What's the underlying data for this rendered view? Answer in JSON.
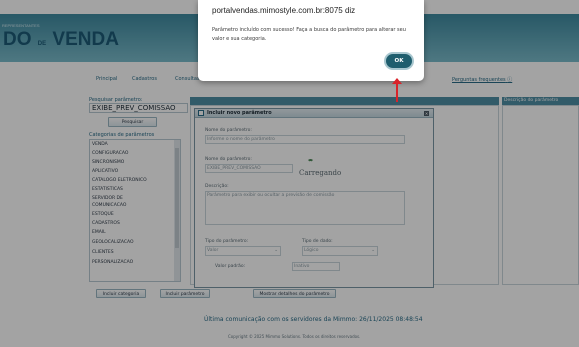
{
  "header": {
    "brand_small": "REPRESENTANTES",
    "brand_left": "DO",
    "brand_de": "DE",
    "brand_right": "VENDA"
  },
  "nav": {
    "items": [
      "Principal",
      "Cadastros",
      "Consultas"
    ],
    "help_link": "Perguntas frequentes"
  },
  "left_panel": {
    "search_label": "Pesquisar parâmetro:",
    "search_value": "EXIBE_PREV_COMISSAO",
    "search_button": "Pesquisar",
    "categories_label": "Categorias de parâmetros",
    "categories": [
      "VENDA",
      "CONFIGURACAO",
      "SINCRONISMO",
      "APLICATIVO",
      "CATALOGO ELETRONICO",
      "ESTATISTICAS",
      "SERVIDOR DE",
      "COMUNICACAO",
      "ESTOQUE",
      "CADASTROS",
      "EMAIL",
      "GEOLOCALIZACAO",
      "CLIENTES",
      "PERSONALIZACAO"
    ]
  },
  "bottom_buttons": {
    "add_category": "Incluir categoria",
    "add_parameter": "Incluir parâmetro",
    "show_details": "Mostrar detalhes do parâmetro"
  },
  "right_panel": {
    "description_header": "Descrição do parâmetro"
  },
  "footer": {
    "last_comm": "Última comunicação com os servidores da Mimmo: 26/11/2025 08:48:54",
    "copyright": "Copyright © 2025 Mimmo Solutions. Todos os direitos reservados."
  },
  "modal": {
    "title": "Incluir novo parâmetro",
    "name_label": "Nome do parâmetro:",
    "name_placeholder": "Informe o nome do parâmetro",
    "short_name_label": "Nome do parâmetro:",
    "short_name_value": "EXIBE_PREV_COMISSAO",
    "description_label": "Descrição:",
    "description_value": "Parâmetro para exibir ou ocultar a previsão de comissão",
    "type_label": "Tipo do parâmetro:",
    "type_value": "Valor",
    "data_type_label": "Tipo de dado:",
    "data_type_value": "Lógico",
    "default_label": "Valor padrão:",
    "default_value": "Inativo",
    "loading_text": "Carregando"
  },
  "alert": {
    "title": "portalvendas.mimostyle.com.br:8075 diz",
    "message": "Parâmetro incluído com sucesso! Faça a busca do parâmetro para alterar seu valor e sua categoria.",
    "ok_label": "OK"
  },
  "colors": {
    "brand_dark": "#1d5b78",
    "alert_ok": "#1f5e6e",
    "arrow": "#d9232a"
  }
}
